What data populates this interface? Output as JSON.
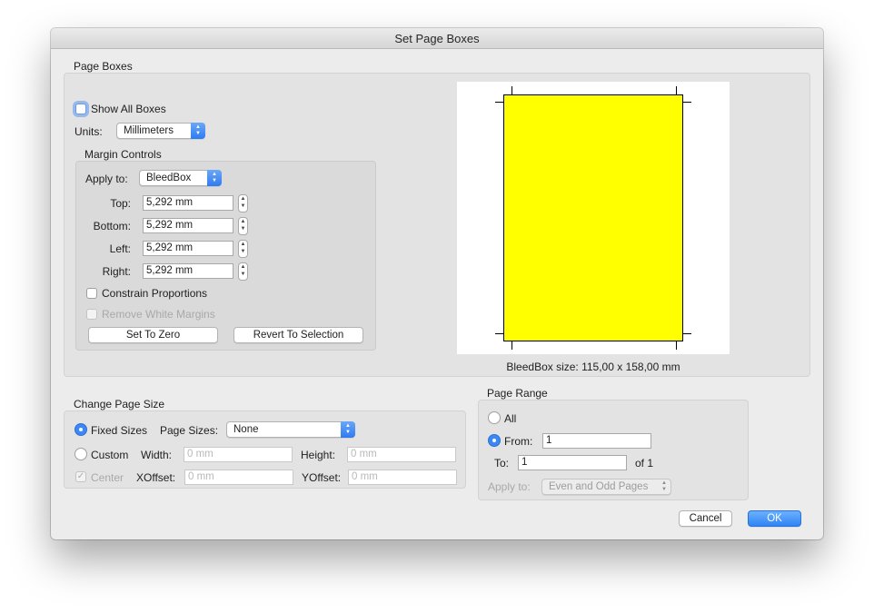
{
  "window": {
    "title": "Set Page Boxes"
  },
  "page_boxes": {
    "section_label": "Page Boxes",
    "show_all_boxes": {
      "label": "Show All Boxes",
      "checked": false
    },
    "units": {
      "label": "Units:",
      "value": "Millimeters"
    },
    "margin_controls": {
      "section_label": "Margin Controls",
      "apply_to": {
        "label": "Apply to:",
        "value": "BleedBox"
      },
      "top": {
        "label": "Top:",
        "value": "5,292 mm"
      },
      "bottom": {
        "label": "Bottom:",
        "value": "5,292 mm"
      },
      "left": {
        "label": "Left:",
        "value": "5,292 mm"
      },
      "right": {
        "label": "Right:",
        "value": "5,292 mm"
      },
      "constrain_proportions": {
        "label": "Constrain Proportions",
        "checked": false
      },
      "remove_white_margins": {
        "label": "Remove White Margins",
        "checked": false,
        "enabled": false
      },
      "set_to_zero_label": "Set To Zero",
      "revert_to_selection_label": "Revert To Selection"
    },
    "preview": {
      "box_color": "#ffff00",
      "size_caption": "BleedBox size: 115,00 x 158,00 mm"
    }
  },
  "change_page_size": {
    "section_label": "Change Page Size",
    "fixed_sizes": {
      "label": "Fixed Sizes",
      "selected": true
    },
    "page_sizes": {
      "label": "Page Sizes:",
      "value": "None"
    },
    "custom": {
      "label": "Custom",
      "selected": false
    },
    "width": {
      "label": "Width:",
      "placeholder": "0 mm"
    },
    "height": {
      "label": "Height:",
      "placeholder": "0 mm"
    },
    "center": {
      "label": "Center",
      "checked": true,
      "enabled": false
    },
    "xoffset": {
      "label": "XOffset:",
      "placeholder": "0 mm"
    },
    "yoffset": {
      "label": "YOffset:",
      "placeholder": "0 mm"
    }
  },
  "page_range": {
    "section_label": "Page Range",
    "all": {
      "label": "All",
      "selected": false
    },
    "from": {
      "label": "From:",
      "value": "1",
      "selected": true
    },
    "to": {
      "label": "To:",
      "value": "1"
    },
    "of_label": "of 1",
    "apply_to": {
      "label": "Apply to:",
      "value": "Even and Odd Pages",
      "enabled": false
    }
  },
  "buttons": {
    "cancel_label": "Cancel",
    "ok_label": "OK"
  },
  "icons": {
    "stepper": "stepper-arrows-icon",
    "popup": "popup-chevrons-icon",
    "checkmark": "checkmark-icon"
  }
}
